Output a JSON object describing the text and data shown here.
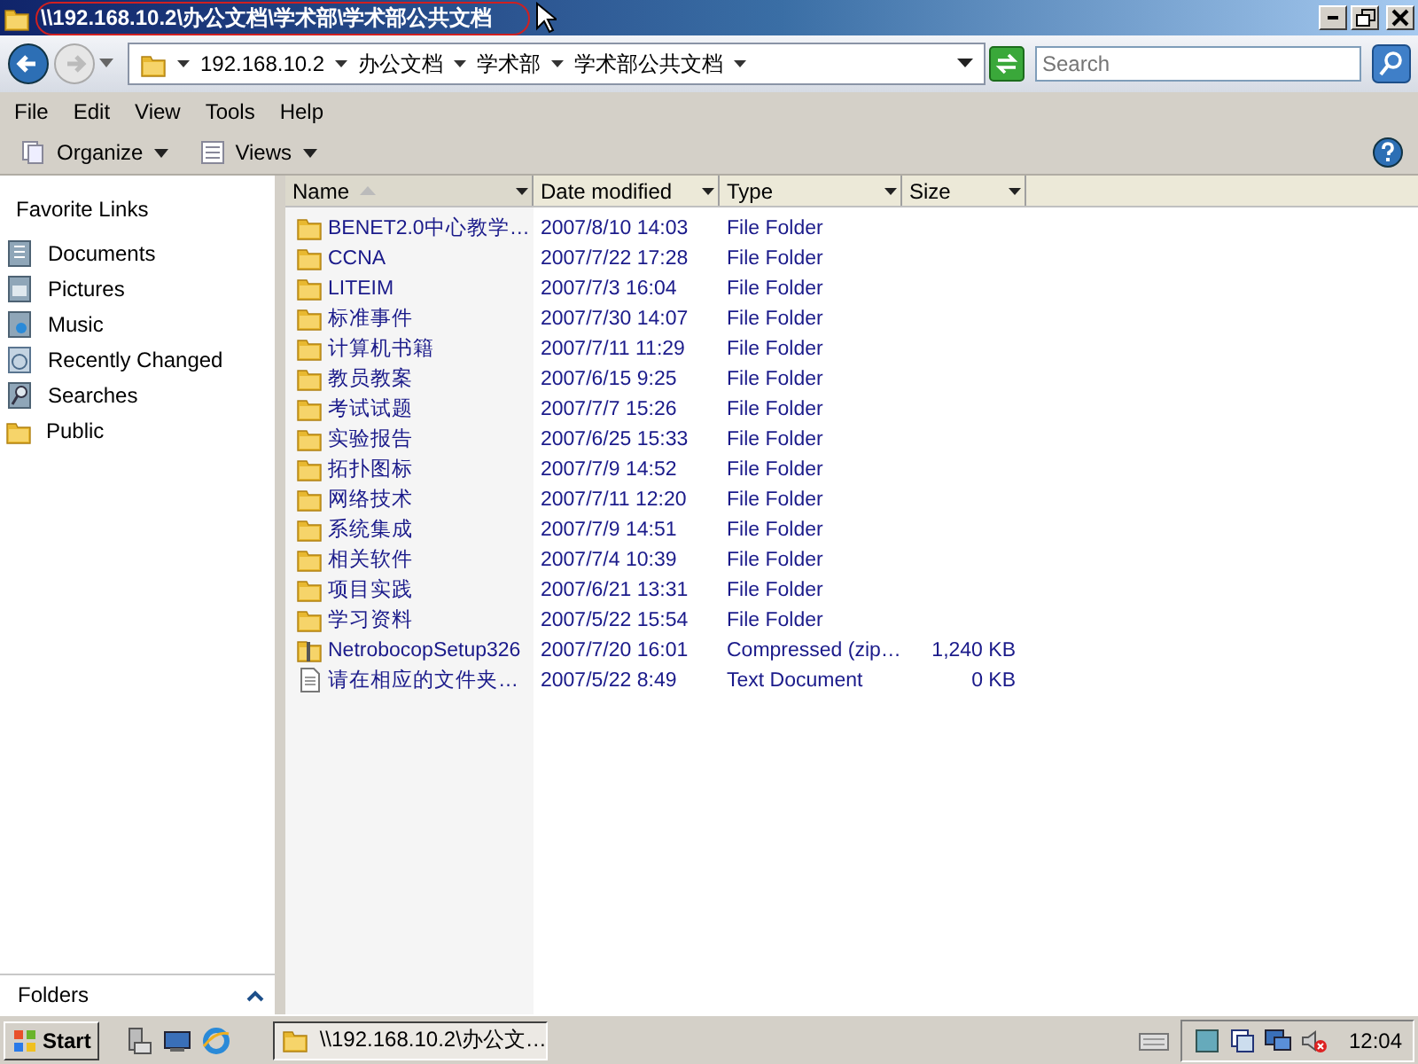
{
  "window": {
    "title": "\\\\192.168.10.2\\办公文档\\学术部\\学术部公共文档"
  },
  "address_bar": {
    "segments": [
      "192.168.10.2",
      "办公文档",
      "学术部",
      "学术部公共文档"
    ]
  },
  "search": {
    "placeholder": "Search"
  },
  "menu": [
    "File",
    "Edit",
    "View",
    "Tools",
    "Help"
  ],
  "toolbar": [
    "Organize",
    "Views"
  ],
  "sidebar": {
    "title": "Favorite Links",
    "items": [
      {
        "label": "Documents",
        "kind": "documents"
      },
      {
        "label": "Pictures",
        "kind": "pictures"
      },
      {
        "label": "Music",
        "kind": "music"
      },
      {
        "label": "Recently Changed",
        "kind": "recent"
      },
      {
        "label": "Searches",
        "kind": "searches"
      },
      {
        "label": "Public",
        "kind": "folder"
      }
    ],
    "folders_label": "Folders"
  },
  "table": {
    "columns": [
      {
        "label": "Name",
        "sorted": true
      },
      {
        "label": "Date modified",
        "sorted": false
      },
      {
        "label": "Type",
        "sorted": false
      },
      {
        "label": "Size",
        "sorted": false
      }
    ],
    "rows": [
      {
        "kind": "folder",
        "name": "BENET2.0中心教学…",
        "date": "2007/8/10 14:03",
        "type": "File Folder",
        "size": ""
      },
      {
        "kind": "folder",
        "name": "CCNA",
        "date": "2007/7/22 17:28",
        "type": "File Folder",
        "size": ""
      },
      {
        "kind": "folder",
        "name": "LITEIM",
        "date": "2007/7/3 16:04",
        "type": "File Folder",
        "size": ""
      },
      {
        "kind": "folder",
        "name": "标准事件",
        "date": "2007/7/30 14:07",
        "type": "File Folder",
        "size": ""
      },
      {
        "kind": "folder",
        "name": "计算机书籍",
        "date": "2007/7/11 11:29",
        "type": "File Folder",
        "size": ""
      },
      {
        "kind": "folder",
        "name": "教员教案",
        "date": "2007/6/15 9:25",
        "type": "File Folder",
        "size": ""
      },
      {
        "kind": "folder",
        "name": "考试试题",
        "date": "2007/7/7 15:26",
        "type": "File Folder",
        "size": ""
      },
      {
        "kind": "folder",
        "name": "实验报告",
        "date": "2007/6/25 15:33",
        "type": "File Folder",
        "size": ""
      },
      {
        "kind": "folder",
        "name": "拓扑图标",
        "date": "2007/7/9 14:52",
        "type": "File Folder",
        "size": ""
      },
      {
        "kind": "folder",
        "name": "网络技术",
        "date": "2007/7/11 12:20",
        "type": "File Folder",
        "size": ""
      },
      {
        "kind": "folder",
        "name": "系统集成",
        "date": "2007/7/9 14:51",
        "type": "File Folder",
        "size": ""
      },
      {
        "kind": "folder",
        "name": "相关软件",
        "date": "2007/7/4 10:39",
        "type": "File Folder",
        "size": ""
      },
      {
        "kind": "folder",
        "name": "项目实践",
        "date": "2007/6/21 13:31",
        "type": "File Folder",
        "size": ""
      },
      {
        "kind": "folder",
        "name": "学习资料",
        "date": "2007/5/22 15:54",
        "type": "File Folder",
        "size": ""
      },
      {
        "kind": "zip",
        "name": "NetrobocopSetup326",
        "date": "2007/7/20 16:01",
        "type": "Compressed (zip…",
        "size": "1,240 KB"
      },
      {
        "kind": "text",
        "name": "请在相应的文件夹…",
        "date": "2007/5/22 8:49",
        "type": "Text Document",
        "size": "0 KB"
      }
    ]
  },
  "taskbar": {
    "start": "Start",
    "task": "\\\\192.168.10.2\\办公文…",
    "clock": "12:04"
  }
}
